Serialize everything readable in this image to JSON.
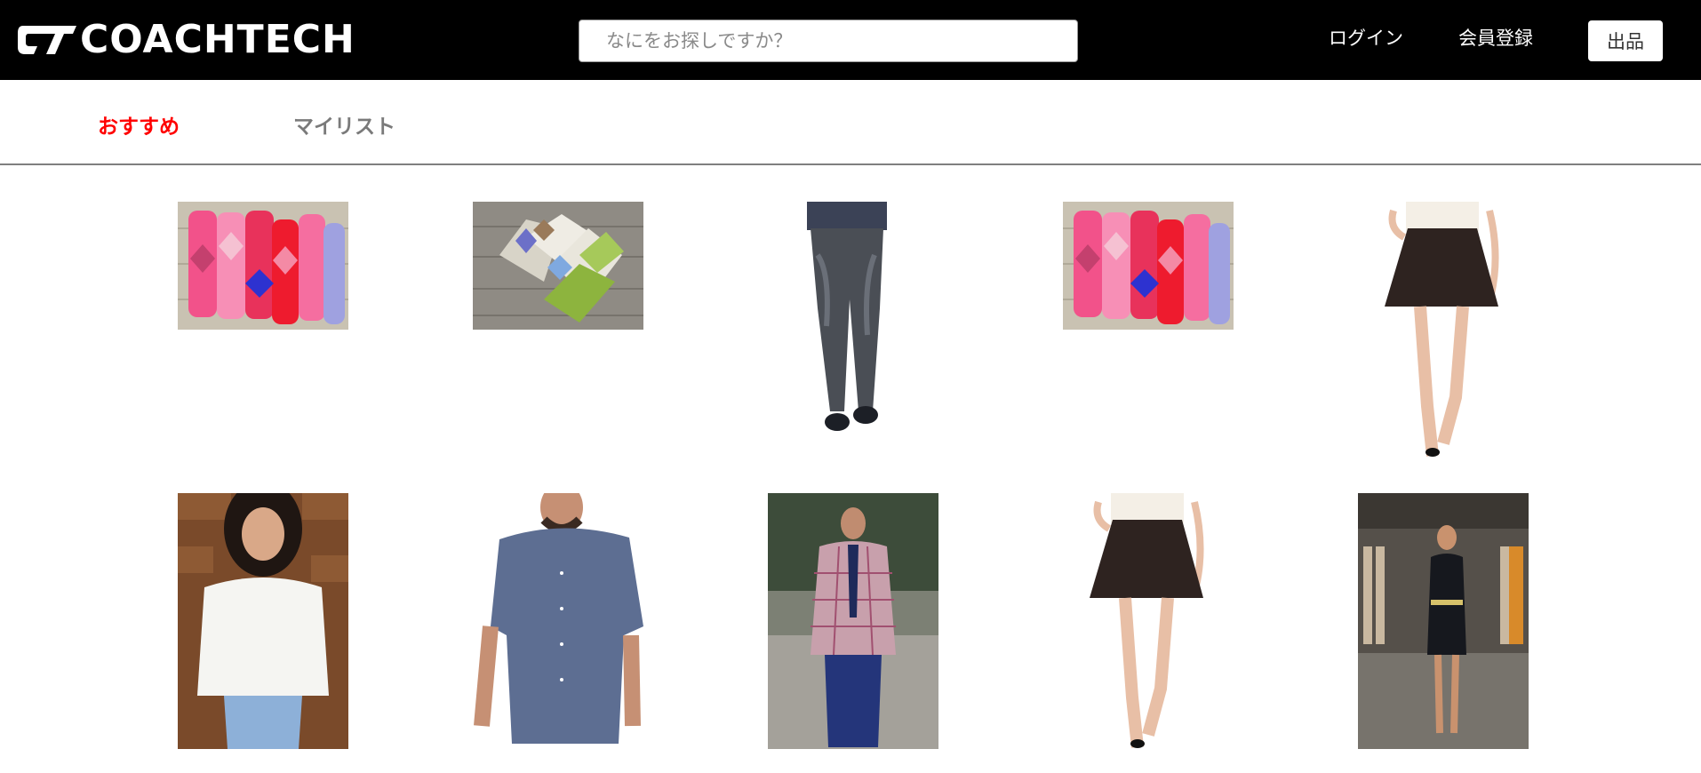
{
  "header": {
    "logo_text": "COACHTECH",
    "search_placeholder": "なにをお探しですか？",
    "login_label": "ログイン",
    "register_label": "会員登録",
    "sell_label": "出品"
  },
  "tabs": [
    {
      "label": "おすすめ",
      "active": true
    },
    {
      "label": "マイリスト",
      "active": false
    }
  ],
  "colors": {
    "header_bg": "#000000",
    "active_tab": "#ff0000",
    "inactive_tab": "#7a7a7a"
  },
  "items": [
    {
      "image": "pink-argyle-socks"
    },
    {
      "image": "green-argyle-socks"
    },
    {
      "image": "jeans"
    },
    {
      "image": "pink-argyle-socks"
    },
    {
      "image": "black-skirt"
    },
    {
      "image": "woman-white-blouse"
    },
    {
      "image": "blue-shirt"
    },
    {
      "image": "man-plaid-blazer"
    },
    {
      "image": "black-skirt"
    },
    {
      "image": "woman-black-dress"
    }
  ]
}
